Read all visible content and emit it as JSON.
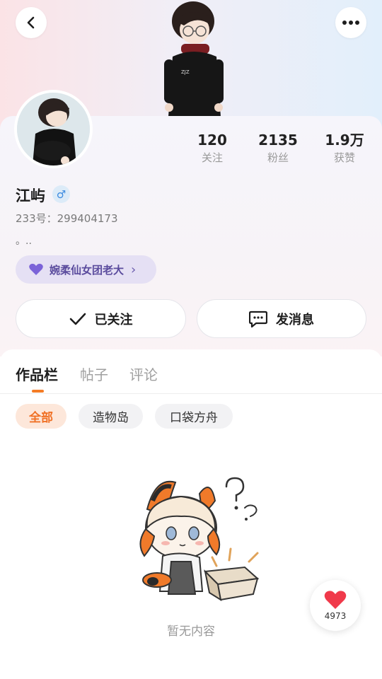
{
  "header": {
    "back_icon": "chevron-left-icon",
    "more_icon": "ellipsis-icon"
  },
  "profile": {
    "name": "江屿",
    "gender_symbol": "♂",
    "user_id": "233号：299404173",
    "bio": "。..",
    "group_tag": "婉柔仙女团老大",
    "group_tag_arrow": "›"
  },
  "stats": [
    {
      "value": "120",
      "label": "关注"
    },
    {
      "value": "2135",
      "label": "粉丝"
    },
    {
      "value": "1.9万",
      "label": "获赞"
    }
  ],
  "actions": {
    "follow_label": "已关注",
    "message_label": "发消息"
  },
  "tabs": [
    {
      "label": "作品栏",
      "active": true
    },
    {
      "label": "帖子",
      "active": false
    },
    {
      "label": "评论",
      "active": false
    }
  ],
  "filters": [
    {
      "label": "全部",
      "active": true
    },
    {
      "label": "造物岛",
      "active": false
    },
    {
      "label": "口袋方舟",
      "active": false
    }
  ],
  "empty_state": {
    "text": "暂无内容"
  },
  "like_fab": {
    "count": "4973"
  },
  "colors": {
    "accent": "#f47c25",
    "tag_bg": "#e5e0f4",
    "tag_text": "#5a4b9d",
    "gender_blue": "#3c8be0",
    "heart_red": "#f0394a"
  }
}
